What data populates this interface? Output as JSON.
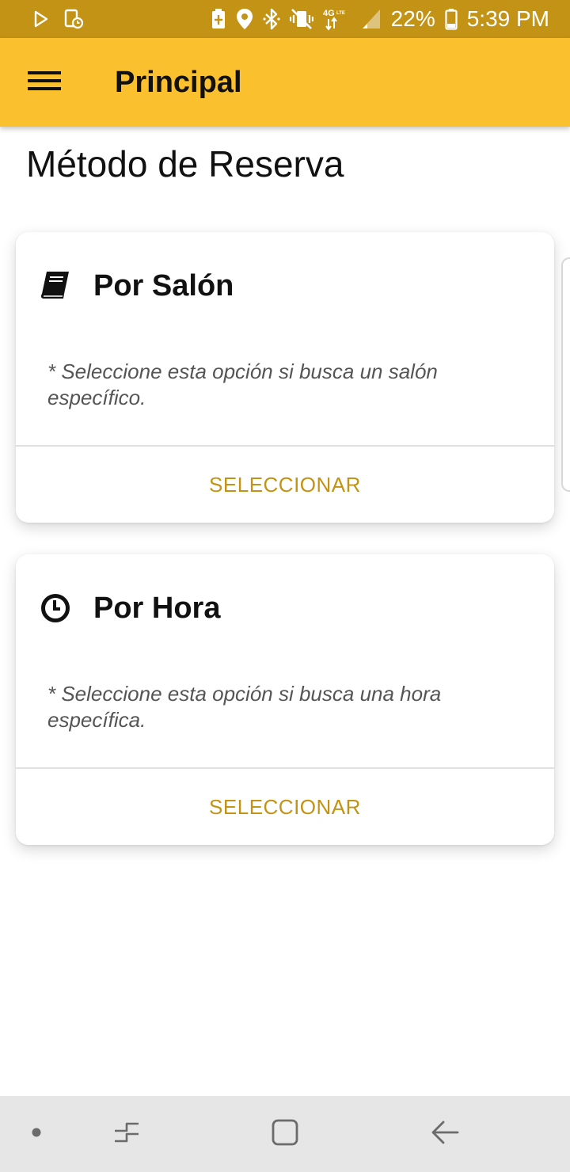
{
  "status_bar": {
    "battery_percent": "22%",
    "time": "5:39 PM",
    "network": "4G LTE",
    "left_icons": [
      "play-store-icon",
      "screen-timer-icon"
    ],
    "right_icons": [
      "battery-saver-icon",
      "location-icon",
      "bluetooth-icon",
      "vibrate-icon",
      "network-4g-icon",
      "signal-icon",
      "battery-icon"
    ]
  },
  "app_bar": {
    "title": "Principal",
    "menu_icon": "hamburger-menu-icon"
  },
  "page": {
    "heading": "Método de Reserva"
  },
  "cards": [
    {
      "icon": "book-icon",
      "title": "Por Salón",
      "description": "* Seleccione esta opción si busca un salón específico.",
      "action_label": "SELECCIONAR"
    },
    {
      "icon": "clock-icon",
      "title": "Por Hora",
      "description": "* Seleccione esta opción si busca una hora específica.",
      "action_label": "SELECCIONAR"
    }
  ],
  "nav_bar": {
    "buttons": [
      "dot-icon",
      "recents-icon",
      "home-icon",
      "back-icon"
    ]
  },
  "colors": {
    "status_bar": "#c39315",
    "app_bar": "#fbc02d",
    "accent_text": "#c39315",
    "nav_bar": "#e6e6e6"
  }
}
